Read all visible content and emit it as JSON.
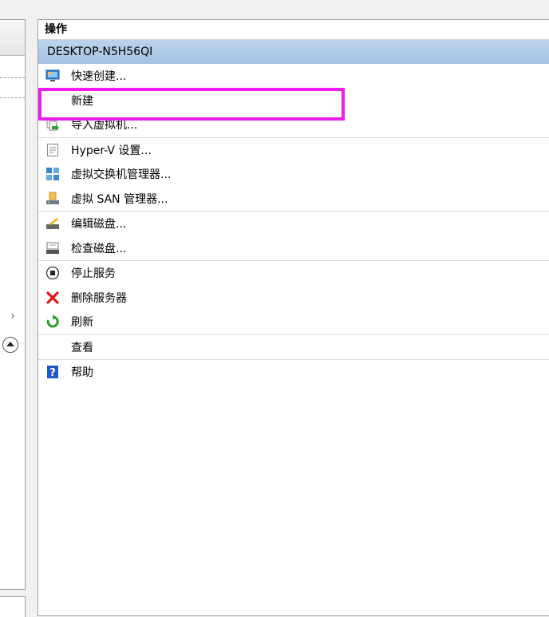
{
  "actions_pane": {
    "title": "操作",
    "section_title": "DESKTOP-N5H56QI",
    "items": [
      {
        "label": "快速创建...",
        "icon": "quick-create-icon"
      },
      {
        "label": "新建",
        "icon": ""
      },
      {
        "label": "导入虚拟机...",
        "icon": "import-vm-icon"
      },
      {
        "label": "Hyper-V 设置...",
        "icon": "settings-document-icon"
      },
      {
        "label": "虚拟交换机管理器...",
        "icon": "virtual-switch-icon"
      },
      {
        "label": "虚拟 SAN 管理器...",
        "icon": "san-manager-icon"
      },
      {
        "label": "编辑磁盘...",
        "icon": "edit-disk-icon"
      },
      {
        "label": "检查磁盘...",
        "icon": "inspect-disk-icon"
      },
      {
        "label": "停止服务",
        "icon": "stop-icon"
      },
      {
        "label": "删除服务器",
        "icon": "delete-x-icon"
      },
      {
        "label": "刷新",
        "icon": "refresh-icon"
      },
      {
        "label": "查看",
        "icon": ""
      },
      {
        "label": "帮助",
        "icon": "help-icon"
      }
    ]
  },
  "left_pane": {
    "scroll_arrow": "›"
  },
  "colors": {
    "highlight": "#ee1cf0",
    "section_header": "#b3cce6",
    "delete": "#e0161b",
    "refresh": "#2f9d2f",
    "help": "#2456c7"
  }
}
